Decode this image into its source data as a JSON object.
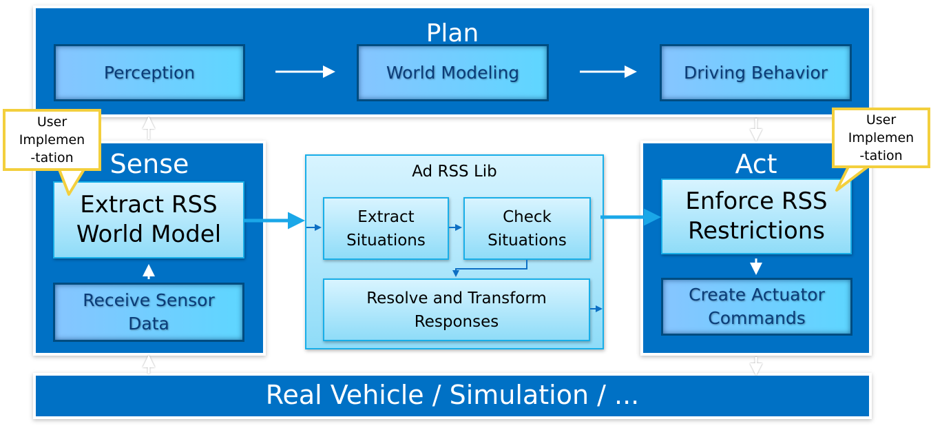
{
  "plan": {
    "title": "Plan",
    "boxes": [
      "Perception",
      "World Modeling",
      "Driving Behavior"
    ]
  },
  "sense": {
    "title": "Sense",
    "main": "Extract RSS\nWorld Model",
    "sub": "Receive Sensor\nData"
  },
  "lib": {
    "title": "Ad RSS Lib",
    "extract": "Extract\nSituations",
    "check": "Check\nSituations",
    "resolve": "Resolve and Transform\nResponses"
  },
  "act": {
    "title": "Act",
    "main": "Enforce RSS\nRestrictions",
    "sub": "Create Actuator\nCommands"
  },
  "bottom": {
    "title": "Real Vehicle / Simulation / ..."
  },
  "callouts": {
    "left": "User\nImplemen\n-tation",
    "right": "User\nImplemen\n-tation"
  },
  "colors": {
    "panel": "#0071c5",
    "light_border": "#18aee8",
    "callout": "#f3cf3d",
    "arrow": "#1aa7e8"
  }
}
